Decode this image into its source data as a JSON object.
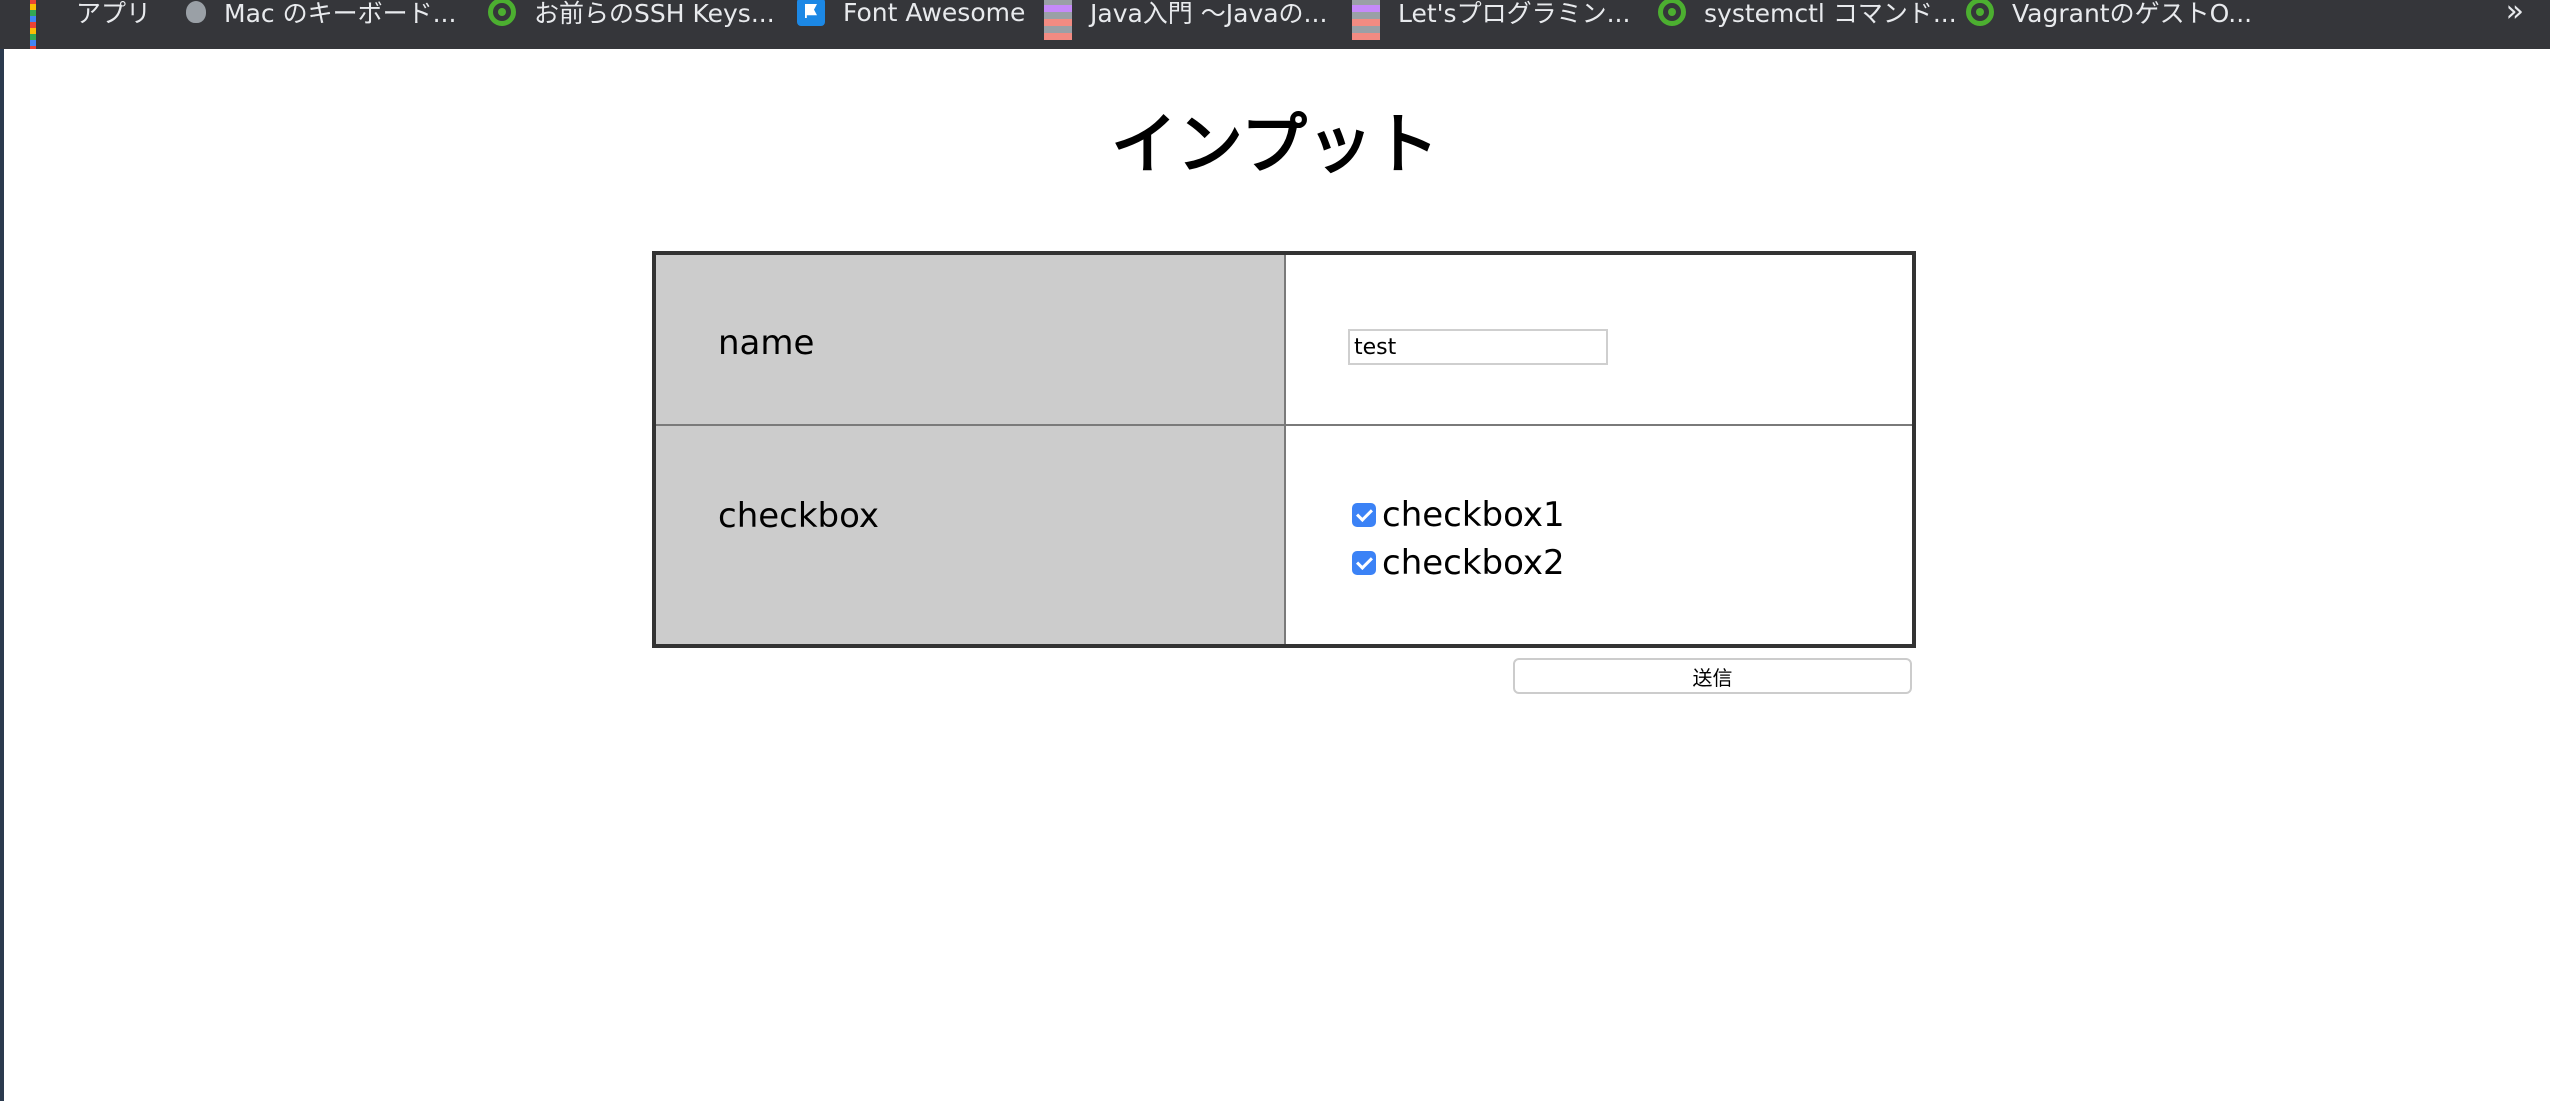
{
  "bookmarks": {
    "apps_label": "アプリ",
    "items": [
      {
        "label": "Mac のキーボード..."
      },
      {
        "label": "お前らのSSH Keys..."
      },
      {
        "label": "Font Awesome"
      },
      {
        "label": "Java入門 〜Javaの..."
      },
      {
        "label": "Let'sプログラミン..."
      },
      {
        "label": "systemctl コマンド..."
      },
      {
        "label": "VagrantのゲストO..."
      }
    ],
    "overflow": "»"
  },
  "page": {
    "title": "インプット"
  },
  "form": {
    "name_label": "name",
    "name_value": "test",
    "checkbox_label": "checkbox",
    "checkboxes": [
      {
        "label": "checkbox1",
        "checked": true
      },
      {
        "label": "checkbox2",
        "checked": true
      }
    ],
    "submit_label": "送信"
  },
  "colors": {
    "bookmark_bar_bg": "#35363a",
    "label_cell_bg": "#cccccc",
    "checkbox_accent": "#3b82f6"
  }
}
